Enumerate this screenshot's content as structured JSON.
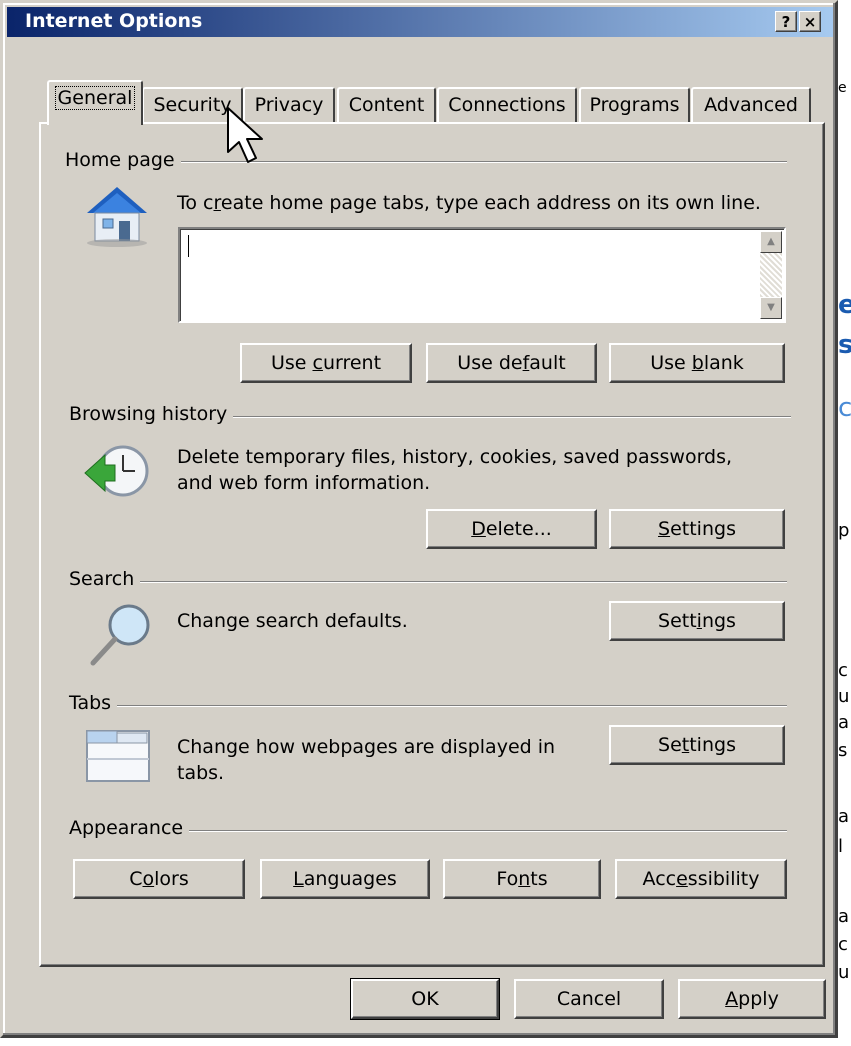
{
  "window": {
    "title": "Internet Options",
    "help_button": "?",
    "close_button": "×"
  },
  "tabs": [
    {
      "label": "General",
      "active": true
    },
    {
      "label": "Security",
      "active": false
    },
    {
      "label": "Privacy",
      "active": false
    },
    {
      "label": "Content",
      "active": false
    },
    {
      "label": "Connections",
      "active": false
    },
    {
      "label": "Programs",
      "active": false
    },
    {
      "label": "Advanced",
      "active": false
    }
  ],
  "home_page": {
    "group_label": "Home page",
    "description_pre": "To c",
    "description_u": "r",
    "description_post": "eate home page tabs, type each address on its own line.",
    "field_value": "",
    "buttons": {
      "use_current_pre": "Use ",
      "use_current_u": "c",
      "use_current_post": "urrent",
      "use_default_pre": "Use de",
      "use_default_u": "f",
      "use_default_post": "ault",
      "use_blank_pre": "Use ",
      "use_blank_u": "b",
      "use_blank_post": "lank"
    }
  },
  "browsing_history": {
    "group_label": "Browsing history",
    "description_line1": "Delete temporary files, history, cookies, saved passwords,",
    "description_line2": "and web form information.",
    "delete_u": "D",
    "delete_post": "elete...",
    "settings_u": "S",
    "settings_post": "ettings"
  },
  "search": {
    "group_label": "Search",
    "description": "Change search defaults.",
    "settings_pre": "Sett",
    "settings_u": "i",
    "settings_post": "ngs"
  },
  "tabs_section": {
    "group_label": "Tabs",
    "description_line1": "Change how webpages are displayed in",
    "description_line2": "tabs.",
    "settings_pre": "Se",
    "settings_u": "t",
    "settings_post": "tings"
  },
  "appearance": {
    "group_label": "Appearance",
    "colors_pre": "C",
    "colors_u": "o",
    "colors_post": "lors",
    "languages_u": "L",
    "languages_post": "anguages",
    "fonts_pre": "Fo",
    "fonts_u": "n",
    "fonts_post": "ts",
    "accessibility_pre": "Acc",
    "accessibility_u": "e",
    "accessibility_post": "ssibility"
  },
  "footer": {
    "ok": "OK",
    "cancel": "Cancel",
    "apply_u": "A",
    "apply_post": "pply"
  },
  "colors": {
    "titlebar_start": "#0a246a",
    "titlebar_end": "#a6caf0",
    "face": "#d4d0c8"
  }
}
